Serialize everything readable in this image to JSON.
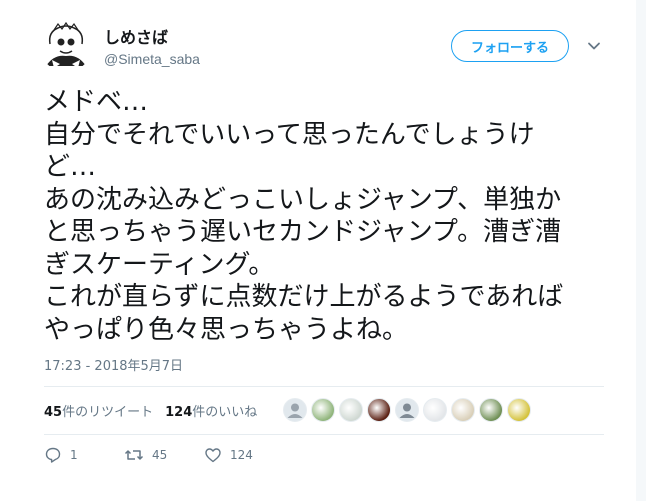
{
  "user": {
    "display_name": "しめさば",
    "handle": "@Simeta_saba",
    "avatar": "avatar-illustration"
  },
  "follow_button": {
    "label": "フォロー​する"
  },
  "menu": {
    "icon": "chevron-down-icon"
  },
  "tweet": {
    "lines": [
      "メドベ…",
      "自分でそれでいいって思ったんでしょうけ",
      "ど…",
      "あの沈み込みどっこいしょジャンプ、単独か",
      "と思っちゃう遅いセカンドジャンプ。漕ぎ漕",
      "ぎスケーティング。",
      "これが直らずに点数だけ上がるようであれば",
      "やっぱり色々思っちゃうよね。"
    ]
  },
  "timestamp": "17:23 - 2018年5月7日",
  "stats": {
    "retweet_count": "45",
    "retweet_label": "件のリツイート",
    "like_count": "124",
    "like_label": "件のいいね"
  },
  "likers": [
    {
      "color": "#9aa4ad",
      "icon": "default-avatar"
    },
    {
      "color": "#8fb47a",
      "icon": "avatar"
    },
    {
      "color": "#cfd8d2",
      "icon": "avatar"
    },
    {
      "color": "#5a1f12",
      "icon": "avatar"
    },
    {
      "color": "#7f8a94",
      "icon": "default-avatar"
    },
    {
      "color": "#e3e6e9",
      "icon": "avatar"
    },
    {
      "color": "#d9cfb8",
      "icon": "avatar"
    },
    {
      "color": "#6f8f54",
      "icon": "avatar"
    },
    {
      "color": "#d4c23a",
      "icon": "avatar"
    }
  ],
  "actions": {
    "reply_count": "1",
    "retweet_count": "45",
    "like_count": "124"
  },
  "colors": {
    "accent": "#1da1f2",
    "muted": "#657786",
    "text": "#14171a",
    "divider": "#e6ecf0"
  }
}
